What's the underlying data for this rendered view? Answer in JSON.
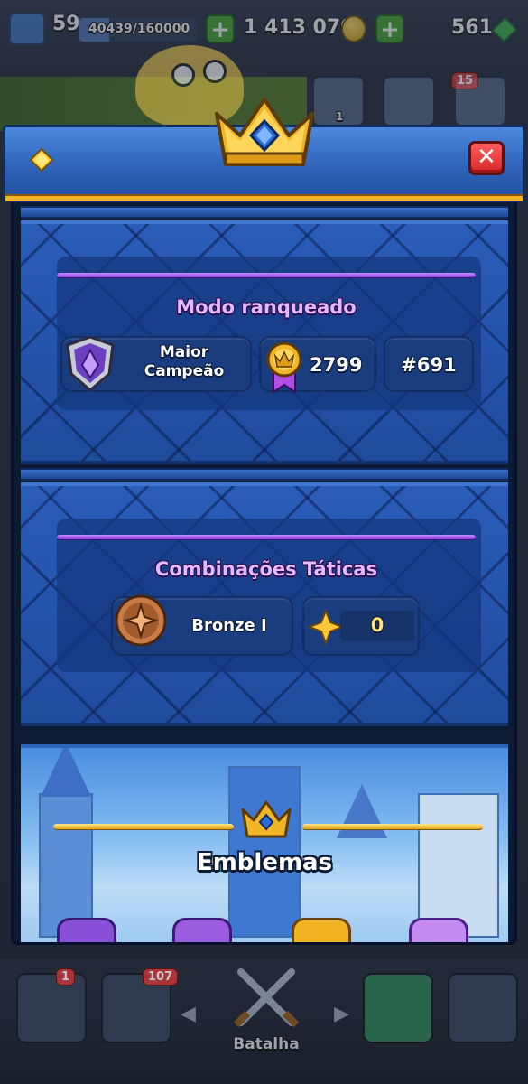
{
  "top_bar": {
    "level": "59",
    "xp": "40439/160000",
    "gold": "1 413 070",
    "gems": "561"
  },
  "top_icons": {
    "social_count": "1",
    "menu_badge": "15"
  },
  "modal": {
    "ranked": {
      "title": "Modo ranqueado",
      "league": "Maior Campeão",
      "trophies": "2799",
      "rank": "#691"
    },
    "tactics": {
      "title": "Combinações Táticas",
      "league": "Bronze I",
      "stars": "0"
    },
    "emblems": {
      "title": "Emblemas"
    }
  },
  "bottom_nav": {
    "cards_badge": "1",
    "collection_badge": "107",
    "battle_label": "Batalha"
  },
  "colors": {
    "panel_blue": "#2352a8",
    "header_blue": "#3a70c8",
    "gold": "#f0b425",
    "purple_title": "#e4b8ff",
    "close_red": "#e23a3a"
  },
  "icons": {
    "header_left": "diamond-icon",
    "close": "close-icon",
    "ranked_league": "purple-shield-icon",
    "trophy_medal": "crown-medal-icon",
    "tactics_league": "bronze-star-emblem-icon",
    "tactics_stars": "gold-star-icon",
    "emblems_crown": "blue-gem-crown-icon"
  }
}
